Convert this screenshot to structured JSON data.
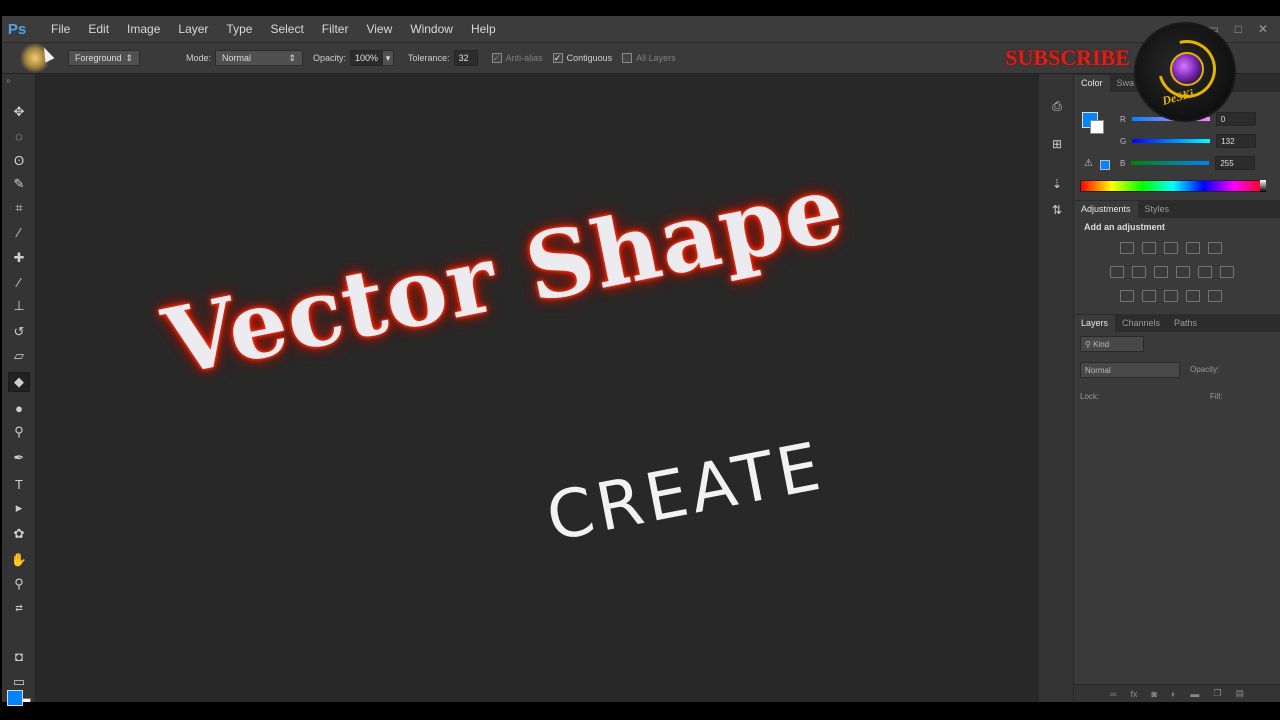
{
  "app": {
    "logo": "Ps"
  },
  "menu": [
    "File",
    "Edit",
    "Image",
    "Layer",
    "Type",
    "Select",
    "Filter",
    "View",
    "Window",
    "Help"
  ],
  "window_controls": [
    "▭",
    "□",
    "✕"
  ],
  "options_bar": {
    "fill_source": "Foreground",
    "mode_label": "Mode:",
    "mode_value": "Normal",
    "opacity_label": "Opacity:",
    "opacity_value": "100%",
    "tolerance_label": "Tolerance:",
    "tolerance_value": "32",
    "anti_alias_label": "Anti-alias",
    "anti_alias_checked": true,
    "contiguous_label": "Contiguous",
    "contiguous_checked": true,
    "all_layers_label": "All Layers",
    "all_layers_checked": false
  },
  "overlay": {
    "subscribe": "SUBSCRIBE",
    "badge_text": "DeSKi"
  },
  "canvas": {
    "headline": "Vector Shape",
    "subheadline": "CREATE"
  },
  "tools": [
    "move-tool",
    "marquee-tool",
    "lasso-tool",
    "quick-select-tool",
    "crop-tool",
    "eyedropper-tool",
    "healing-brush-tool",
    "brush-tool",
    "clone-stamp-tool",
    "history-brush-tool",
    "eraser-tool",
    "paint-bucket-tool",
    "blur-tool",
    "dodge-tool",
    "pen-tool",
    "type-tool",
    "path-select-tool",
    "shape-tool",
    "hand-tool",
    "zoom-tool"
  ],
  "colors": {
    "foreground": "#0084ff",
    "background": "#ffffff",
    "glow": "#ff2a0a",
    "subscribe": "#d8201b"
  },
  "color_panel": {
    "tabs": [
      "Color",
      "Swa"
    ],
    "channels": [
      {
        "name": "R",
        "value": "0"
      },
      {
        "name": "G",
        "value": "132"
      },
      {
        "name": "B",
        "value": "255"
      }
    ]
  },
  "adjustments_panel": {
    "tabs": [
      "Adjustments",
      "Styles"
    ],
    "heading": "Add an adjustment"
  },
  "layers_panel": {
    "tabs": [
      "Layers",
      "Channels",
      "Paths"
    ],
    "kind_label": "Kind",
    "blend_mode": "Normal",
    "opacity_label": "Opacity:",
    "lock_label": "Lock:",
    "fill_label": "Fill:",
    "footer_icons": [
      "link-icon",
      "fx-icon",
      "mask-icon",
      "adjustment-icon",
      "folder-icon",
      "new-layer-icon",
      "trash-icon"
    ]
  }
}
